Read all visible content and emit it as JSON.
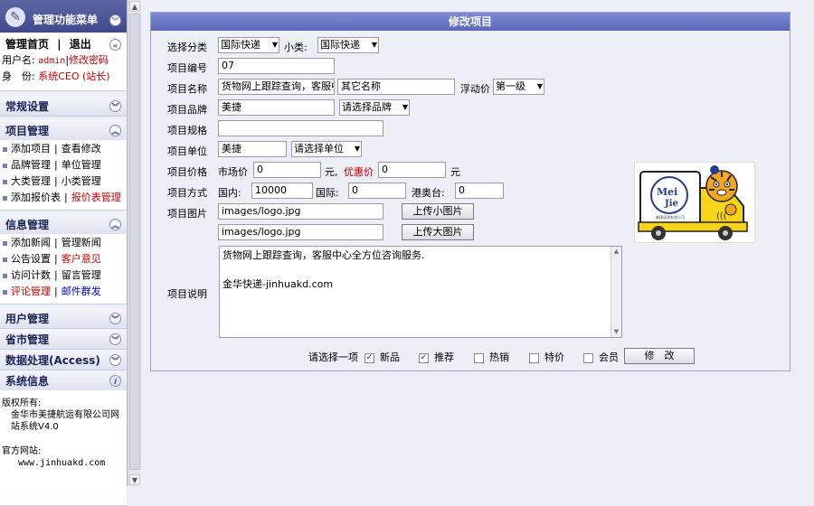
{
  "sidebar": {
    "title": "管理功能菜单",
    "nav": {
      "home": "管理首页",
      "sep": "|",
      "logout": "退出"
    },
    "user": {
      "name_label": "用户名:",
      "name_value": "admin",
      "sep": "|",
      "change_pw": "修改密码",
      "role_label": "身　份:",
      "role_value": "系统CEO (站长)"
    },
    "sections": [
      {
        "title": "常规设置"
      },
      {
        "title": "项目管理",
        "rows": [
          [
            "添加项目",
            "查看修改"
          ],
          [
            "品牌管理",
            "单位管理"
          ],
          [
            "大类管理",
            "小类管理"
          ],
          [
            "添加报价表",
            "报价表管理"
          ]
        ]
      },
      {
        "title": "信息管理",
        "rows": [
          [
            "添加新闻",
            "管理新闻"
          ],
          [
            "公告设置",
            "客户意见"
          ],
          [
            "访问计数",
            "留言管理"
          ],
          [
            "评论管理",
            "邮件群发"
          ]
        ]
      },
      {
        "title": "用户管理"
      },
      {
        "title": "省市管理"
      },
      {
        "title": "数据处理(Access)"
      },
      {
        "title": "系统信息"
      }
    ],
    "info": {
      "copyright_label": "版权所有:",
      "copyright_value": "金华市美捷航运有限公司网站系统V4.0",
      "site_label": "官方网站:",
      "site_value": "www.jinhuakd.com"
    }
  },
  "form": {
    "title": "修改项目",
    "category": {
      "label": "选择分类",
      "big": "国际快递",
      "small_label": "小类:",
      "small": "国际快递"
    },
    "code": {
      "label": "项目编号",
      "value": "07"
    },
    "name": {
      "label": "项目名称",
      "value": "货物网上跟踪查询，客服中心全方位咨询服务",
      "other": "其它名称",
      "float_label": "浮动价",
      "float_value": "第一级"
    },
    "brand": {
      "label": "项目品牌",
      "value": "美捷",
      "select": "请选择品牌"
    },
    "spec": {
      "label": "项目规格",
      "value": ""
    },
    "unit": {
      "label": "项目单位",
      "value": "美捷",
      "select": "请选择单位"
    },
    "price": {
      "label": "项目价格",
      "market_label": "市场价",
      "market_value": "0",
      "unit": "元",
      "sep": ",",
      "promo_label": "优惠价",
      "promo_value": "0",
      "unit2": "元"
    },
    "mode": {
      "label": "项目方式",
      "domestic_label": "国内:",
      "domestic_value": "10000",
      "intl_label": "国际:",
      "intl_value": "0",
      "hkmo_label": "港奥台:",
      "hkmo_value": "0"
    },
    "image": {
      "label": "项目图片",
      "small_value": "images/logo.jpg",
      "small_btn": "上传小图片",
      "big_value": "images/logo.jpg",
      "big_btn": "上传大图片"
    },
    "desc": {
      "label": "项目说明",
      "line1": "货物网上跟踪查询，客服中心全方位咨询服务.",
      "line2": "",
      "line3": "金华快递-jinhuakd.com"
    },
    "options": {
      "prompt": "请选择一项",
      "items": [
        {
          "label": "新品",
          "checked": true
        },
        {
          "label": "推荐",
          "checked": true
        },
        {
          "label": "热销",
          "checked": false
        },
        {
          "label": "特价",
          "checked": false
        },
        {
          "label": "会员",
          "checked": false
        }
      ],
      "submit": "修　改"
    },
    "logo_text": {
      "brand_top": "Mei",
      "brand_bottom": "Jie",
      "small": "美捷速递有限公司"
    }
  },
  "colors": {
    "accent": "#5968b8",
    "link_red": "#c00000",
    "link_blue": "#0000c0"
  }
}
